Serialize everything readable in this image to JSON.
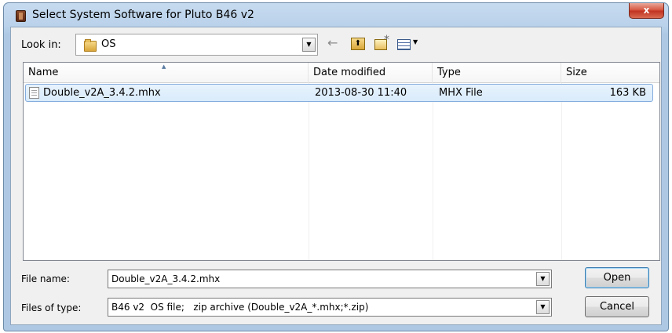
{
  "window": {
    "title": "Select System Software for Pluto B46 v2",
    "close_glyph": "x"
  },
  "toolbar": {
    "look_in_label": "Look in:",
    "look_in_value": "OS",
    "icons": [
      "back-arrow-icon",
      "up-folder-icon",
      "new-folder-icon",
      "view-menu-icon"
    ]
  },
  "list": {
    "columns": [
      "Name",
      "Date modified",
      "Type",
      "Size"
    ],
    "sort_indicator": "▲",
    "rows": [
      {
        "name": "Double_v2A_3.4.2.mhx",
        "date": "2013-08-30 11:40",
        "type": "MHX File",
        "size": "163 KB"
      }
    ]
  },
  "file_name": {
    "label": "File name:",
    "value": "Double_v2A_3.4.2.mhx"
  },
  "file_type": {
    "label": "Files of type:",
    "value": "B46 v2  OS file;   zip archive (Double_v2A_*.mhx;*.zip)"
  },
  "buttons": {
    "open": "Open",
    "cancel": "Cancel"
  },
  "colors": {
    "title_bar": "#b9d1ea",
    "selection": "#d9ebfb",
    "close_button": "#c03020"
  }
}
